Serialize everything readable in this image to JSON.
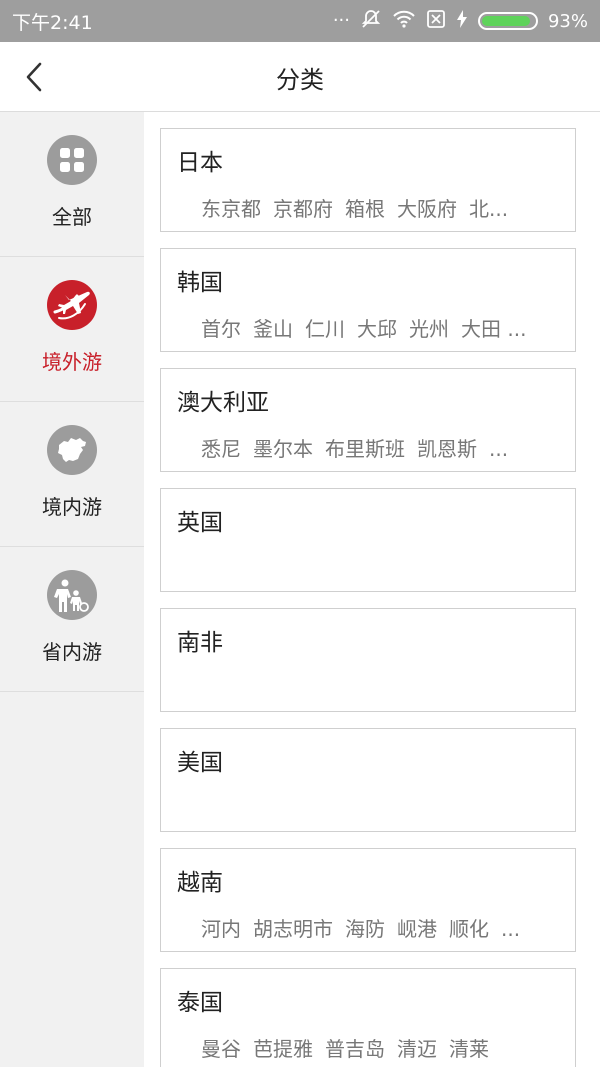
{
  "status_bar": {
    "time": "下午2:41",
    "dots": "···",
    "battery_percent": "93%",
    "battery_level": 0.93
  },
  "header": {
    "title": "分类"
  },
  "sidebar": {
    "items": [
      {
        "label": "全部",
        "icon": "grid-icon",
        "active": false
      },
      {
        "label": "境外游",
        "icon": "airplane-globe-icon",
        "active": true
      },
      {
        "label": "境内游",
        "icon": "china-map-icon",
        "active": false
      },
      {
        "label": "省内游",
        "icon": "family-search-icon",
        "active": false
      }
    ]
  },
  "categories": [
    {
      "name": "日本",
      "cities": [
        "东京都",
        "京都府",
        "箱根",
        "大阪府",
        "北..."
      ]
    },
    {
      "name": "韩国",
      "cities": [
        "首尔",
        "釜山",
        "仁川",
        "大邱",
        "光州",
        "大田 ..."
      ]
    },
    {
      "name": "澳大利亚",
      "cities": [
        "悉尼",
        "墨尔本",
        "布里斯班",
        "凯恩斯",
        "..."
      ]
    },
    {
      "name": "英国",
      "cities": []
    },
    {
      "name": "南非",
      "cities": []
    },
    {
      "name": "美国",
      "cities": []
    },
    {
      "name": "越南",
      "cities": [
        "河内",
        "胡志明市",
        "海防",
        "岘港",
        "顺化",
        "..."
      ]
    },
    {
      "name": "泰国",
      "cities": [
        "曼谷",
        "芭提雅",
        "普吉岛",
        "清迈",
        "清莱"
      ]
    }
  ],
  "colors": {
    "accent": "#c8202a",
    "status_bar": "#9e9e9e",
    "inactive_icon": "#9c9c9c"
  }
}
